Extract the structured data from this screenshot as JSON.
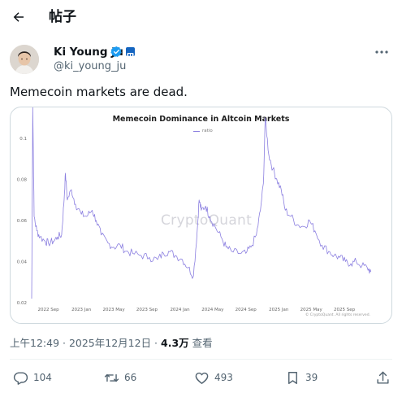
{
  "header": {
    "back_icon": "arrow-left-icon",
    "title": "帖子"
  },
  "author": {
    "name": "Ki Young Ju",
    "handle": "@ki_young_ju",
    "verified_icon": "verified-badge-icon",
    "affiliate_icon": "affiliate-badge-icon",
    "more_icon": "more-icon"
  },
  "tweet": {
    "text": "Memecoin markets are dead."
  },
  "media": {
    "watermark": "CryptoQuant",
    "copyright": "© CryptoQuant. All rights reserved.",
    "chart_data": {
      "type": "line",
      "title": "Memecoin Dominance in Altcoin Markets",
      "legend": [
        "ratio"
      ],
      "x_ticks": [
        "2022 Sep",
        "2023 Jan",
        "2023 May",
        "2023 Sep",
        "2024 Jan",
        "2024 May",
        "2024 Sep",
        "2025 Jan",
        "2025 May",
        "2025 Sep"
      ],
      "y_ticks": [
        "0.02",
        "0.04",
        "0.06",
        "0.08",
        "0.1"
      ],
      "ylim": [
        0.02,
        0.1
      ],
      "grid": false,
      "series": [
        {
          "name": "ratio",
          "color": "#8b7fe0",
          "points": [
            [
              "2022-07-01",
              0.022
            ],
            [
              "2022-07-05",
              0.115
            ],
            [
              "2022-07-10",
              0.062
            ],
            [
              "2022-07-20",
              0.055
            ],
            [
              "2022-08-01",
              0.052
            ],
            [
              "2022-08-20",
              0.05
            ],
            [
              "2022-09-01",
              0.049
            ],
            [
              "2022-09-20",
              0.05
            ],
            [
              "2022-10-05",
              0.052
            ],
            [
              "2022-10-20",
              0.053
            ],
            [
              "2022-10-28",
              0.068
            ],
            [
              "2022-11-03",
              0.083
            ],
            [
              "2022-11-10",
              0.07
            ],
            [
              "2022-11-25",
              0.075
            ],
            [
              "2022-12-10",
              0.068
            ],
            [
              "2023-01-01",
              0.063
            ],
            [
              "2023-01-20",
              0.062
            ],
            [
              "2023-02-10",
              0.065
            ],
            [
              "2023-02-25",
              0.06
            ],
            [
              "2023-03-15",
              0.053
            ],
            [
              "2023-04-10",
              0.049
            ],
            [
              "2023-05-01",
              0.047
            ],
            [
              "2023-05-25",
              0.048
            ],
            [
              "2023-06-15",
              0.045
            ],
            [
              "2023-07-10",
              0.044
            ],
            [
              "2023-08-10",
              0.043
            ],
            [
              "2023-09-10",
              0.042
            ],
            [
              "2023-10-10",
              0.041
            ],
            [
              "2023-11-01",
              0.044
            ],
            [
              "2023-11-20",
              0.045
            ],
            [
              "2023-12-15",
              0.043
            ],
            [
              "2024-01-10",
              0.041
            ],
            [
              "2024-02-01",
              0.037
            ],
            [
              "2024-02-20",
              0.033
            ],
            [
              "2024-03-05",
              0.055
            ],
            [
              "2024-03-12",
              0.07
            ],
            [
              "2024-03-20",
              0.065
            ],
            [
              "2024-04-05",
              0.067
            ],
            [
              "2024-04-20",
              0.062
            ],
            [
              "2024-05-10",
              0.057
            ],
            [
              "2024-06-01",
              0.052
            ],
            [
              "2024-06-20",
              0.047
            ],
            [
              "2024-07-10",
              0.045
            ],
            [
              "2024-08-10",
              0.044
            ],
            [
              "2024-09-01",
              0.044
            ],
            [
              "2024-09-20",
              0.047
            ],
            [
              "2024-10-10",
              0.053
            ],
            [
              "2024-10-25",
              0.065
            ],
            [
              "2024-11-05",
              0.078
            ],
            [
              "2024-11-12",
              0.11
            ],
            [
              "2024-11-25",
              0.092
            ],
            [
              "2024-12-10",
              0.085
            ],
            [
              "2024-12-25",
              0.08
            ],
            [
              "2025-01-10",
              0.075
            ],
            [
              "2025-01-25",
              0.065
            ],
            [
              "2025-02-15",
              0.062
            ],
            [
              "2025-03-10",
              0.058
            ],
            [
              "2025-04-05",
              0.057
            ],
            [
              "2025-04-25",
              0.06
            ],
            [
              "2025-05-15",
              0.055
            ],
            [
              "2025-06-10",
              0.048
            ],
            [
              "2025-07-05",
              0.045
            ],
            [
              "2025-07-25",
              0.043
            ],
            [
              "2025-08-15",
              0.042
            ],
            [
              "2025-09-05",
              0.04
            ],
            [
              "2025-09-25",
              0.039
            ],
            [
              "2025-10-15",
              0.04
            ],
            [
              "2025-11-05",
              0.038
            ],
            [
              "2025-11-25",
              0.037
            ],
            [
              "2025-12-08",
              0.035
            ]
          ]
        }
      ]
    }
  },
  "meta": {
    "time": "上午12:49 · 2025年12月12日 · ",
    "views": "4.3万",
    "views_label": " 查看"
  },
  "actions": {
    "reply": {
      "icon": "reply-icon",
      "count": "104"
    },
    "retweet": {
      "icon": "retweet-icon",
      "count": "66"
    },
    "like": {
      "icon": "like-icon",
      "count": "493"
    },
    "bookmark": {
      "icon": "bookmark-icon",
      "count": "39"
    },
    "share": {
      "icon": "share-icon"
    }
  }
}
